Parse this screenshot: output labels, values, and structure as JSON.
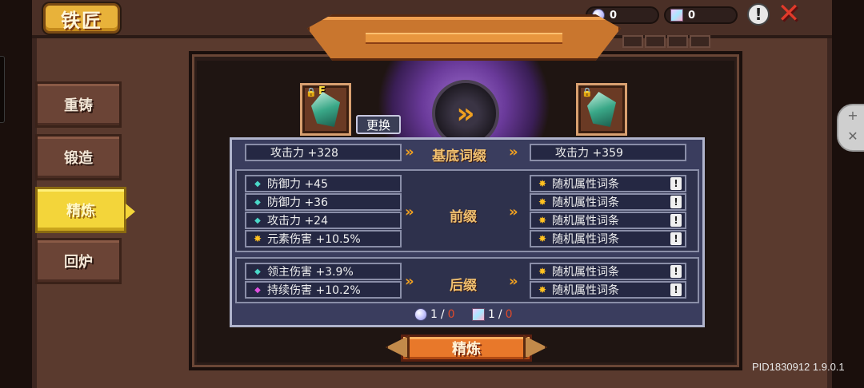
{
  "title": "铁匠",
  "currency": [
    {
      "icon": "white-gem-icon",
      "value": "0"
    },
    {
      "icon": "cube-gem-icon",
      "value": "0"
    }
  ],
  "help_label": "!",
  "close_label": "✕",
  "tabs": [
    {
      "label": "重铸",
      "active": false
    },
    {
      "label": "锻造",
      "active": false
    },
    {
      "label": "精炼",
      "active": true
    },
    {
      "label": "回炉",
      "active": false
    }
  ],
  "item_left": {
    "grade": "E",
    "locked": true
  },
  "item_right": {
    "locked": true
  },
  "change_button": "更换",
  "base": {
    "left": "攻击力 +328",
    "label": "基底词缀",
    "right": "攻击力 +359"
  },
  "prefix": {
    "label": "前缀",
    "left": [
      {
        "marker": "cyan",
        "text": "防御力 +45"
      },
      {
        "marker": "cyan",
        "text": "防御力 +36"
      },
      {
        "marker": "cyan",
        "text": "攻击力 +24"
      },
      {
        "marker": "gold",
        "text": "元素伤害 +10.5%"
      }
    ],
    "right": [
      "随机属性词条",
      "随机属性词条",
      "随机属性词条",
      "随机属性词条"
    ]
  },
  "suffix": {
    "label": "后缀",
    "left": [
      {
        "marker": "cyan",
        "text": "领主伤害 +3.9%"
      },
      {
        "marker": "pink",
        "text": "持续伤害 +10.2%"
      }
    ],
    "right": [
      "随机属性词条",
      "随机属性词条"
    ]
  },
  "cost": [
    {
      "icon": "white-gem-icon",
      "have": "1",
      "need": "0"
    },
    {
      "icon": "cube-gem-icon",
      "have": "1",
      "need": "0"
    }
  ],
  "refine_button": "精炼",
  "version": "PID1830912 1.9.0.1",
  "colors": {
    "accent": "#f0a020",
    "active_tab": "#f3d53a",
    "refine": "#e8782a"
  }
}
